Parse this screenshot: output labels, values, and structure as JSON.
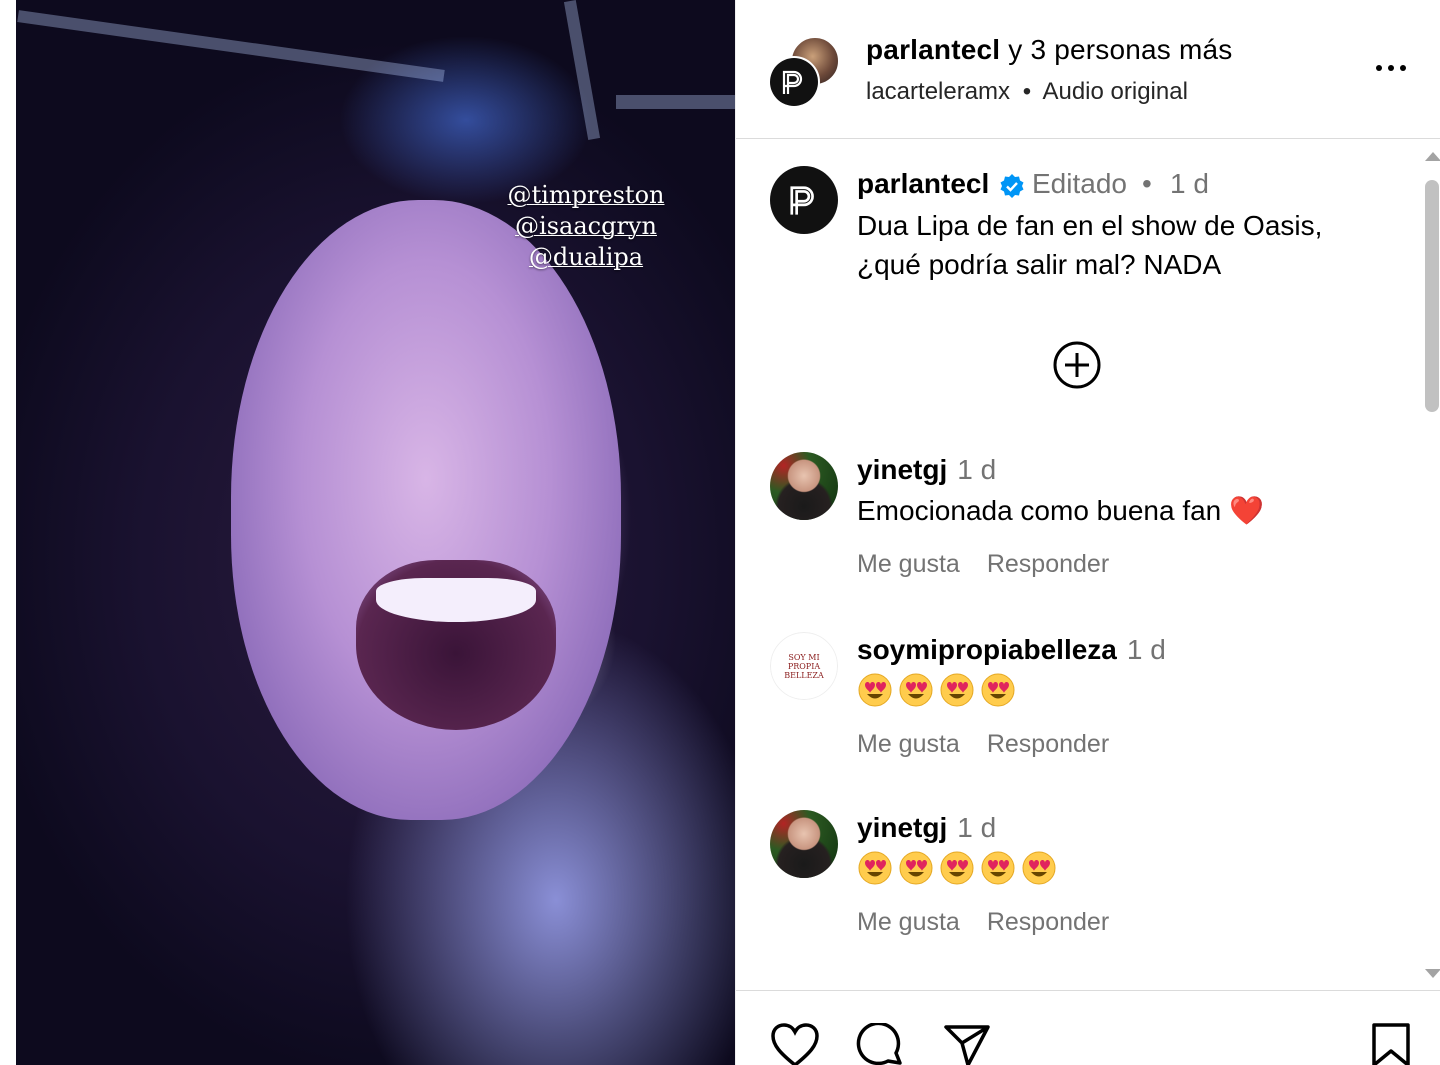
{
  "media": {
    "tags": [
      "@timpreston",
      "@isaacgryn",
      "@dualipa"
    ]
  },
  "header": {
    "author": "parlantecl",
    "collab_suffix": "y 3 personas más",
    "sub_user": "lacarteleramx",
    "sub_separator": "•",
    "audio": "Audio original"
  },
  "caption": {
    "username": "parlantecl",
    "verified": true,
    "edited": "Editado",
    "separator": "•",
    "time": "1 d",
    "text": "Dua Lipa de fan en el show de Oasis, ¿qué podría salir mal? NADA"
  },
  "comments": [
    {
      "username": "yinetgj",
      "time": "1 d",
      "text": "Emocionada como buena fan",
      "text_emoji": "❤️",
      "emojis": [],
      "like_label": "Me gusta",
      "reply_label": "Responder"
    },
    {
      "username": "soymipropiabelleza",
      "avatar_lines": [
        "SOY MI",
        "PROPIA",
        "BELLEZA"
      ],
      "time": "1 d",
      "text": "",
      "emojis": [
        "😍",
        "😍",
        "😍",
        "😍"
      ],
      "like_label": "Me gusta",
      "reply_label": "Responder"
    },
    {
      "username": "yinetgj",
      "time": "1 d",
      "text": "",
      "emojis": [
        "😍",
        "😍",
        "😍",
        "😍",
        "😍"
      ],
      "like_label": "Me gusta",
      "reply_label": "Responder"
    }
  ],
  "actions": {
    "icons": [
      "heart-icon",
      "comment-icon",
      "share-icon",
      "save-icon"
    ]
  },
  "colors": {
    "verified": "#0095f6",
    "muted": "#737373",
    "border": "#dbdbdb",
    "heart": "#e0245e"
  }
}
